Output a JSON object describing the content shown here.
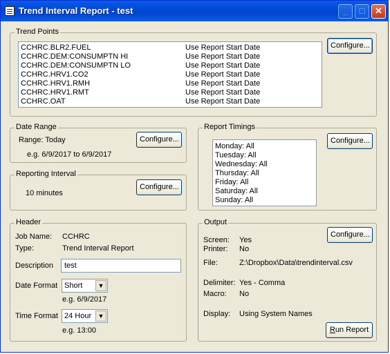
{
  "window": {
    "title": "Trend Interval Report - test",
    "minimize_glyph": "_",
    "maximize_glyph": "□",
    "close_glyph": "✕"
  },
  "trend_points": {
    "legend": "Trend Points",
    "configure_label": "Configure...",
    "items": [
      {
        "point": "CCHRC.BLR2.FUEL",
        "date": "Use Report Start Date"
      },
      {
        "point": "CCHRC.DEM:CONSUMPTN HI",
        "date": "Use Report Start Date"
      },
      {
        "point": "CCHRC.DEM:CONSUMPTN LO",
        "date": "Use Report Start Date"
      },
      {
        "point": "CCHRC.HRV1.CO2",
        "date": "Use Report Start Date"
      },
      {
        "point": "CCHRC.HRV1.RMH",
        "date": "Use Report Start Date"
      },
      {
        "point": "CCHRC.HRV1.RMT",
        "date": "Use Report Start Date"
      },
      {
        "point": "CCHRC.OAT",
        "date": "Use Report Start Date"
      }
    ]
  },
  "date_range": {
    "legend": "Date Range",
    "range_text": "Range: Today",
    "example": "e.g. 6/9/2017 to 6/9/2017",
    "configure_label": "Configure..."
  },
  "reporting_interval": {
    "legend": "Reporting Interval",
    "value": "10 minutes",
    "configure_label": "Configure..."
  },
  "report_timings": {
    "legend": "Report Timings",
    "configure_label": "Configure...",
    "days": [
      "Monday:  All",
      "Tuesday:  All",
      "Wednesday:  All",
      "Thursday:  All",
      "Friday:  All",
      "Saturday:  All",
      "Sunday:  All"
    ]
  },
  "header": {
    "legend": "Header",
    "job_name_label": "Job Name:",
    "job_name_value": "CCHRC",
    "type_label": "Type:",
    "type_value": "Trend Interval Report",
    "description_label": "Description",
    "description_value": "test",
    "date_format_label": "Date Format",
    "date_format_value": "Short",
    "date_format_example": "e.g.  6/9/2017",
    "time_format_label": "Time Format",
    "time_format_value": "24 Hour",
    "time_format_example": "e.g.  13:00"
  },
  "output": {
    "legend": "Output",
    "configure_label": "Configure...",
    "screen_label": "Screen:",
    "screen_value": "Yes",
    "printer_label": "Printer:",
    "printer_value": "No",
    "file_label": "File:",
    "file_value": "Z:\\Dropbox\\Data\\trendinterval.csv",
    "delimiter_label": "Delimiter:",
    "delimiter_value": "Yes - Comma",
    "macro_label": "Macro:",
    "macro_value": "No",
    "display_label": "Display:",
    "display_value": "Using System Names",
    "run_label_underlined": "R",
    "run_label_rest": "un Report"
  }
}
